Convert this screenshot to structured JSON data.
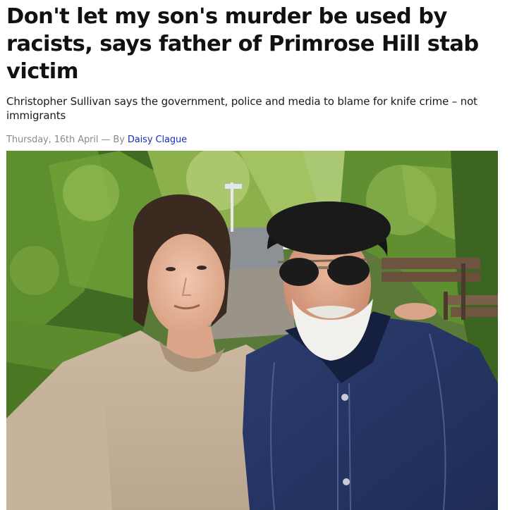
{
  "article": {
    "headline": "Don't let my son's murder be used by racists, says father of Primrose Hill stab victim",
    "standfirst": "Christopher Sullivan says the government, police and media to blame for knife crime – not immigrants",
    "byline": {
      "date": "Thursday, 16th April",
      "separator": " — By ",
      "author": "Daisy Clague"
    }
  },
  "colors": {
    "link": "#1a2fb8",
    "meta": "#8a8a8a",
    "headline": "#111111"
  }
}
